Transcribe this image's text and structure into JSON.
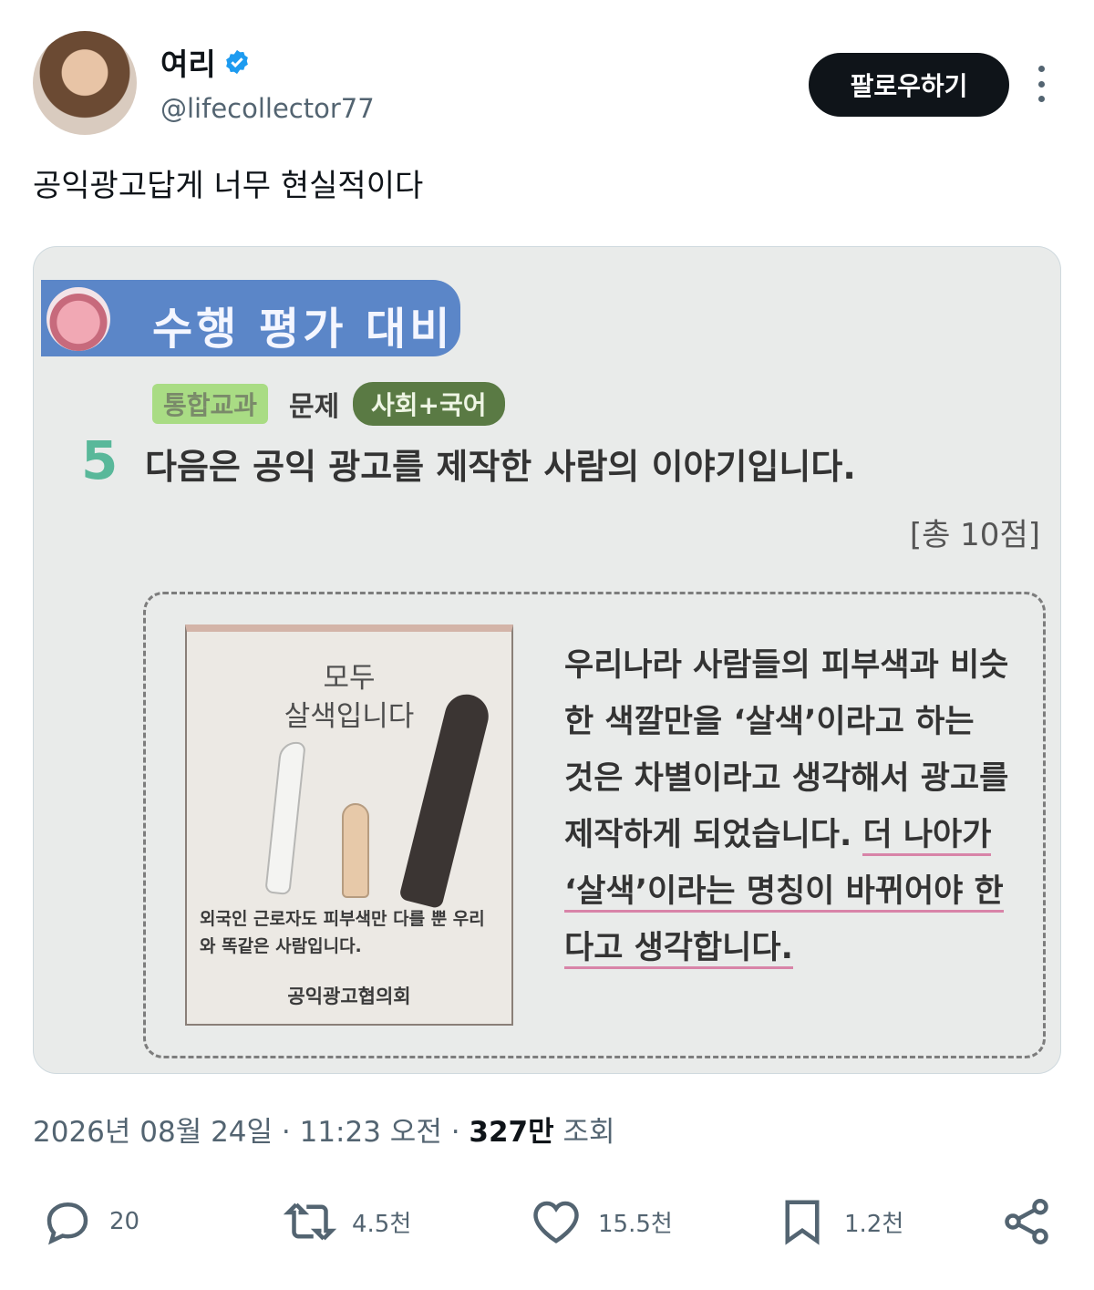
{
  "user": {
    "display_name": "여리",
    "handle": "@lifecollector77",
    "verified": true,
    "follow_label": "팔로우하기"
  },
  "tweet": {
    "text": "공익광고답게 너무 현실적이다"
  },
  "media": {
    "banner": "수행 평가 대비",
    "tag_subject": "통합교과",
    "tag_word": "문제",
    "tag_course": "사회+국어",
    "question_number": "5",
    "question": "다음은 공익 광고를 제작한 사람의 이야기입니다.",
    "score": "[총 10점]",
    "ad_title": "모두\n살색입니다",
    "ad_caption": "외국인 근로자도 피부색만 다를 뿐 우리와 똑같은 사람입니다.",
    "ad_org": "공익광고협의회",
    "para_plain": "우리나라 사람들의 피부색과 비슷한 색깔만을 ‘살색’이라고 하는 것은 차별이라고 생각해서 광고를 제작하게 되었습니다. ",
    "para_underlined": "더 나아가 ‘살색’이라는 명칭이 바뀌어야 한다고 생각합니다."
  },
  "meta": {
    "date": "2026년 08월 24일 · 11:23 오전 · ",
    "views_count": "327만",
    "views_label": " 조회"
  },
  "actions": {
    "replies": "20",
    "retweets": "4.5천",
    "likes": "15.5천",
    "bookmarks": "1.2천"
  },
  "colors": {
    "follow_bg": "#0f1419",
    "verified": "#1d9bf0",
    "muted": "#536471"
  }
}
